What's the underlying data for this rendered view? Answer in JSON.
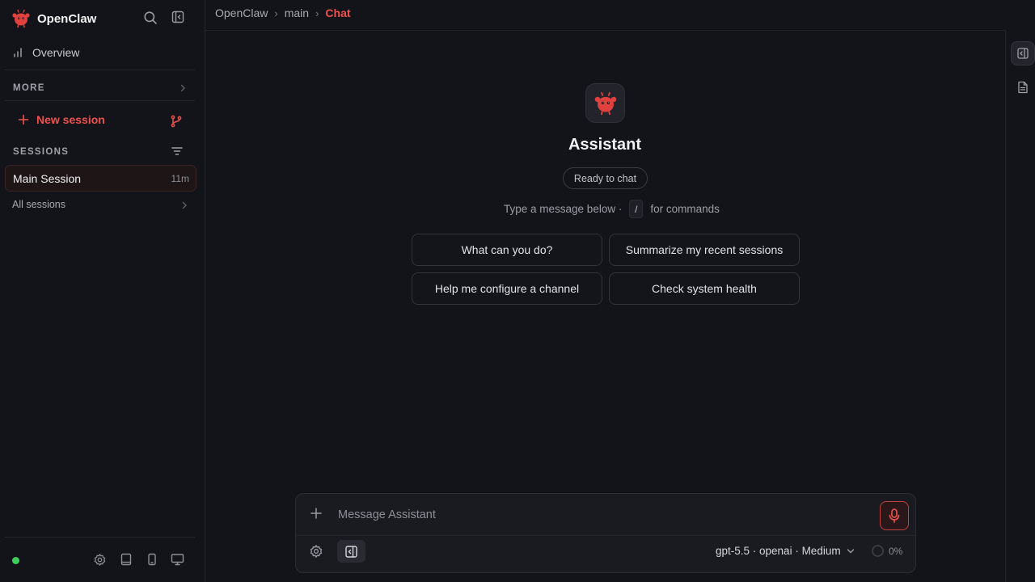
{
  "app": {
    "name": "OpenClaw",
    "accent_color": "#f0514f",
    "status_color": "#3ecf5a"
  },
  "sidebar": {
    "overview_label": "Overview",
    "more_label": "MORE",
    "new_session_label": "New session",
    "sessions_label": "SESSIONS",
    "sessions": [
      {
        "name": "Main Session",
        "age": "11m"
      }
    ],
    "all_sessions_label": "All sessions",
    "footer_icons": [
      "gear-icon",
      "book-icon",
      "phone-icon",
      "monitor-icon"
    ]
  },
  "breadcrumb": {
    "items": [
      "OpenClaw",
      "main"
    ],
    "current": "Chat",
    "separator": "›"
  },
  "chat": {
    "assistant_name": "Assistant",
    "status_pill": "Ready to chat",
    "hint_before": "Type a message below ·",
    "hint_key": "/",
    "hint_after": "for commands",
    "suggestions": [
      "What can you do?",
      "Summarize my recent sessions",
      "Help me configure a channel",
      "Check system health"
    ]
  },
  "composer": {
    "placeholder": "Message Assistant",
    "model_label": "gpt-5.5 · openai · Medium",
    "usage_label": "0%"
  }
}
